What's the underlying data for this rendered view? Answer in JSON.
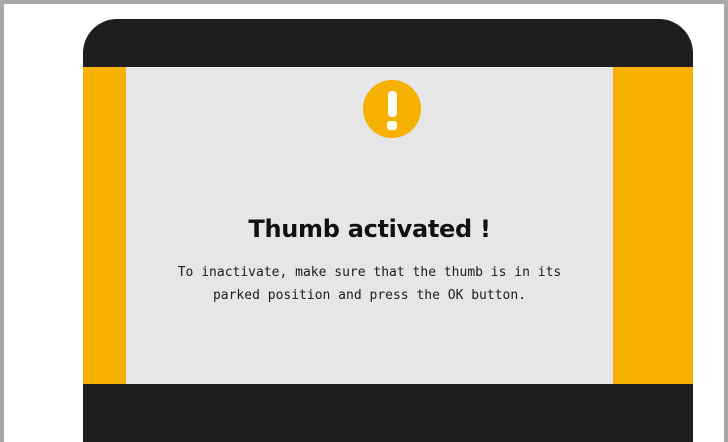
{
  "dialog": {
    "title": "Thumb activated !",
    "message_line_1": "To inactivate, make sure that the thumb is in its",
    "message_line_2": "parked position and press the OK button.",
    "icon": "warning-exclamation-icon",
    "colors": {
      "accent": "#F6B000",
      "panel": "#E6E6E6",
      "device": "#1E1E1E"
    }
  }
}
